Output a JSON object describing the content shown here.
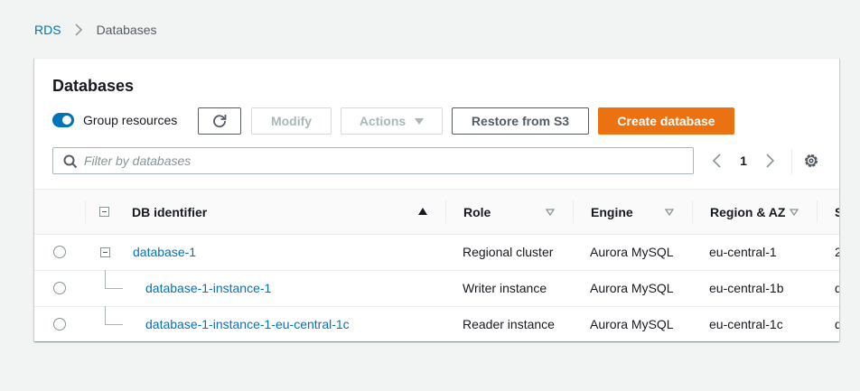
{
  "breadcrumb": {
    "root": "RDS",
    "current": "Databases"
  },
  "panel": {
    "title": "Databases",
    "group_resources_label": "Group resources",
    "group_resources_on": true
  },
  "toolbar": {
    "modify_label": "Modify",
    "actions_label": "Actions",
    "restore_label": "Restore from S3",
    "create_label": "Create database"
  },
  "search": {
    "placeholder": "Filter by databases",
    "value": ""
  },
  "pagination": {
    "current_page": "1"
  },
  "table": {
    "columns": [
      "DB identifier",
      "Role",
      "Engine",
      "Region & AZ",
      "S"
    ],
    "rows": [
      {
        "identifier": "database-1",
        "role": "Regional cluster",
        "engine": "Aurora MySQL",
        "region": "eu-central-1",
        "next": "2"
      },
      {
        "identifier": "database-1-instance-1",
        "role": "Writer instance",
        "engine": "Aurora MySQL",
        "region": "eu-central-1b",
        "next": "d"
      },
      {
        "identifier": "database-1-instance-1-eu-central-1c",
        "role": "Reader instance",
        "engine": "Aurora MySQL",
        "region": "eu-central-1c",
        "next": "d"
      }
    ]
  },
  "colors": {
    "accent": "#0073bb",
    "primary_button": "#ec7211",
    "background": "#f2f3f3"
  }
}
